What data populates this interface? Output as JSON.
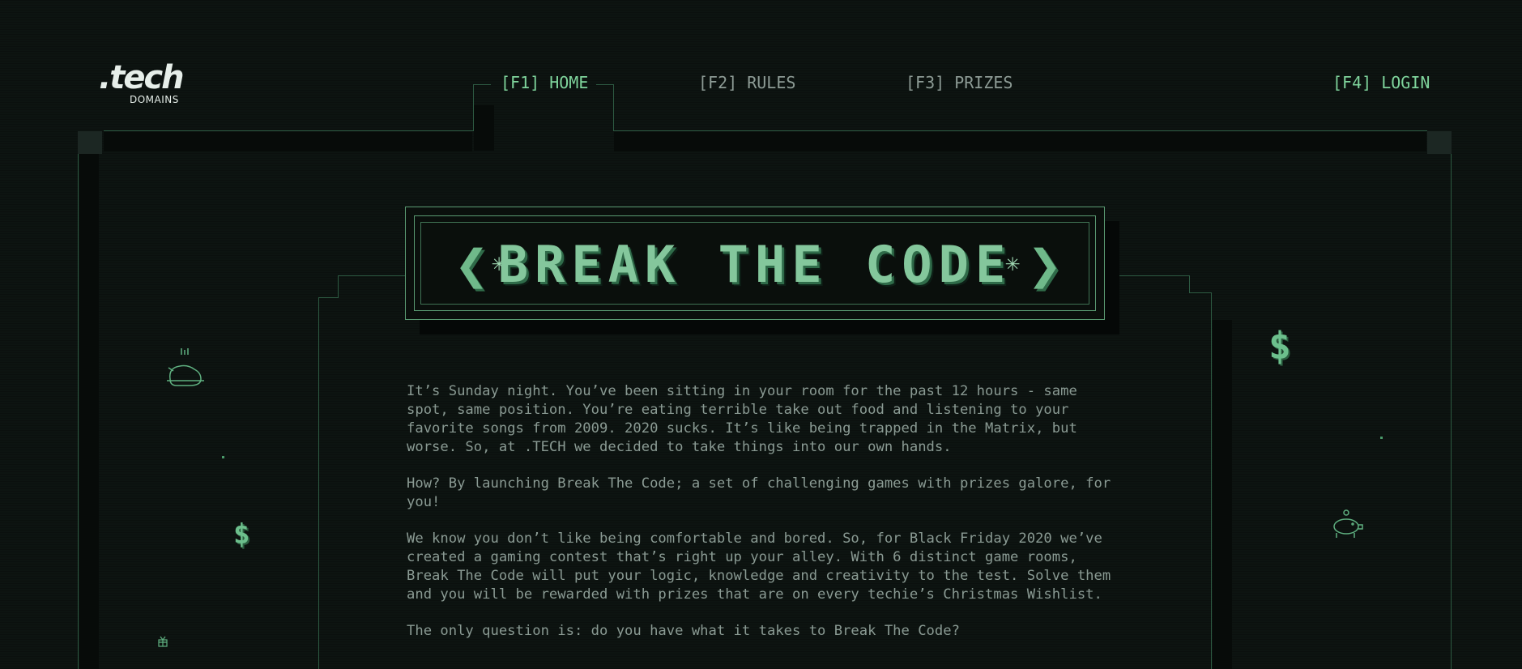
{
  "logo": {
    "main": ".tech",
    "sub": "DOMAINS"
  },
  "nav": {
    "home": "[F1] HOME",
    "rules": "[F2] RULES",
    "prizes": "[F3] PRIZES",
    "login": "[F4] LOGIN",
    "active": "home"
  },
  "hero": {
    "title": "BREAK THE CODE",
    "left_chevron": "❮",
    "right_chevron": "❯",
    "star": "✳"
  },
  "content": {
    "p1": "It’s Sunday night. You’ve been sitting in your room for the past 12 hours - same spot, same position. You’re eating terrible take out food and listening to your favorite songs from 2009. 2020 sucks. It’s like being trapped in the Matrix, but worse. So, at .TECH we decided to take things into our own hands.",
    "p2": "How? By launching Break The Code; a set of challenging games with prizes galore, for you!",
    "p3": "We know you don’t like being comfortable and bored. So, for Black Friday 2020 we’ve created a gaming contest that’s right up your alley. With 6 distinct game rooms, Break The Code will put your logic, knowledge and creativity to the test. Solve them and you will be rewarded with prizes that are on every techie’s Christmas Wishlist.",
    "p4": "The only question is: do you have what it takes to Break The Code?"
  },
  "decorations": {
    "dollar": "$",
    "icons": [
      "roast-chicken-icon",
      "dollar-icon",
      "gift-icon",
      "piggy-bank-icon"
    ]
  },
  "colors": {
    "background": "#0d1411",
    "accent": "#7fd49c",
    "text": "#8a9a93",
    "frame": "#2d5a42"
  }
}
